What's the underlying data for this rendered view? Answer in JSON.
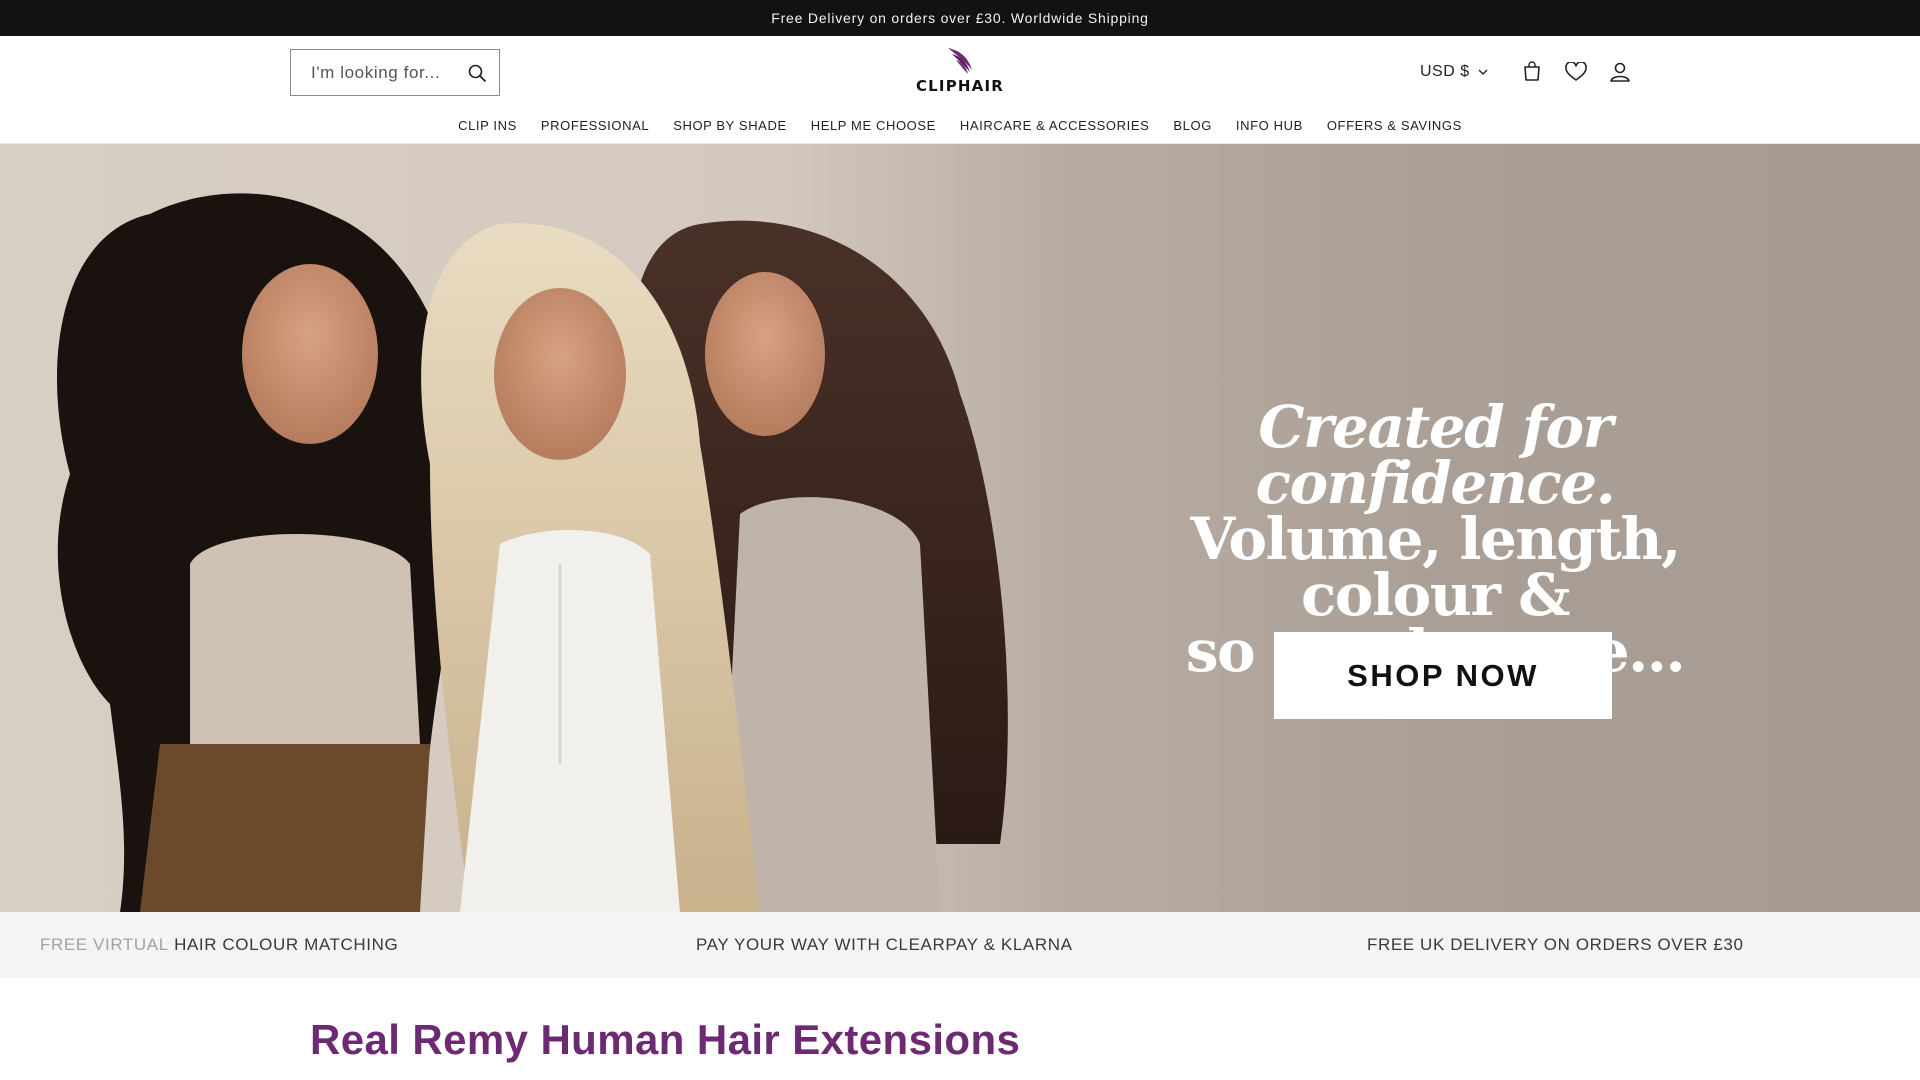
{
  "announcement": {
    "text": "Free Delivery on orders over £30. Worldwide Shipping"
  },
  "header": {
    "search_placeholder": "I'm looking for...",
    "logo_text": "CLIPHAIR",
    "currency": "USD $"
  },
  "nav": {
    "items": [
      {
        "label": "CLIP INS"
      },
      {
        "label": "PROFESSIONAL"
      },
      {
        "label": "SHOP BY SHADE"
      },
      {
        "label": "HELP ME CHOOSE"
      },
      {
        "label": "HAIRCARE & ACCESSORIES"
      },
      {
        "label": "BLOG"
      },
      {
        "label": "INFO HUB"
      },
      {
        "label": "OFFERS & SAVINGS"
      }
    ]
  },
  "hero": {
    "headline_italic": "Created for confidence.",
    "headline_line2": "Volume, length, colour &",
    "headline_line3": "so much more...",
    "cta_label": "SHOP NOW"
  },
  "benefits": {
    "item1_faded": "FREE VIRTUAL",
    "item1_rest": "HAIR COLOUR MATCHING",
    "item2": "PAY YOUR WAY WITH CLEARPAY & KLARNA",
    "item3": "FREE UK DELIVERY ON ORDERS OVER £30"
  },
  "section": {
    "title": "Real Remy Human Hair Extensions"
  },
  "icons": {
    "search": "search-icon",
    "currency_chevron": "chevron-down-icon",
    "cart": "cart-icon",
    "wishlist": "heart-icon",
    "account": "user-icon",
    "logo_mark": "feather-logo-icon"
  },
  "colors": {
    "announcement_bg": "#121212",
    "brand_purple": "#6b2a72",
    "benefits_bg": "#f4f4f4"
  }
}
